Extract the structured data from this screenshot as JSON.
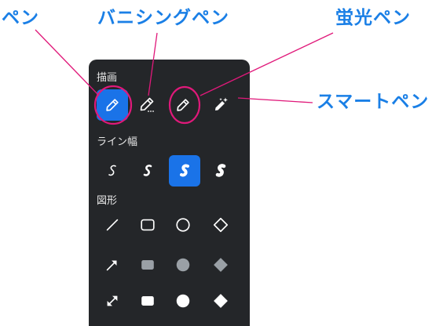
{
  "callouts": {
    "pen": "ペン",
    "vanishing_pen": "バニシングペン",
    "highlighter": "蛍光ペン",
    "smart_pen": "スマートペン"
  },
  "panel": {
    "drawing_label": "描画",
    "line_width_label": "ライン幅",
    "shapes_label": "図形"
  },
  "tools": [
    "pen",
    "vanishing-pen",
    "highlighter",
    "smart-pen"
  ],
  "selected_tool": "pen",
  "line_widths": [
    "thin",
    "medium",
    "thick",
    "extra-thick"
  ],
  "selected_line_width": "thick",
  "shapes": [
    [
      "line",
      "rectangle-outline",
      "circle-outline",
      "diamond-outline"
    ],
    [
      "arrow",
      "rectangle-filled-gray",
      "circle-filled-gray",
      "diamond-filled-gray"
    ],
    [
      "double-arrow",
      "rectangle-filled-white",
      "circle-filled-white",
      "diamond-filled-white"
    ]
  ],
  "colors": {
    "callout_text": "#1a7fe6",
    "annotation": "#e0197a",
    "panel_bg": "#242629",
    "selected": "#1a73e8"
  }
}
